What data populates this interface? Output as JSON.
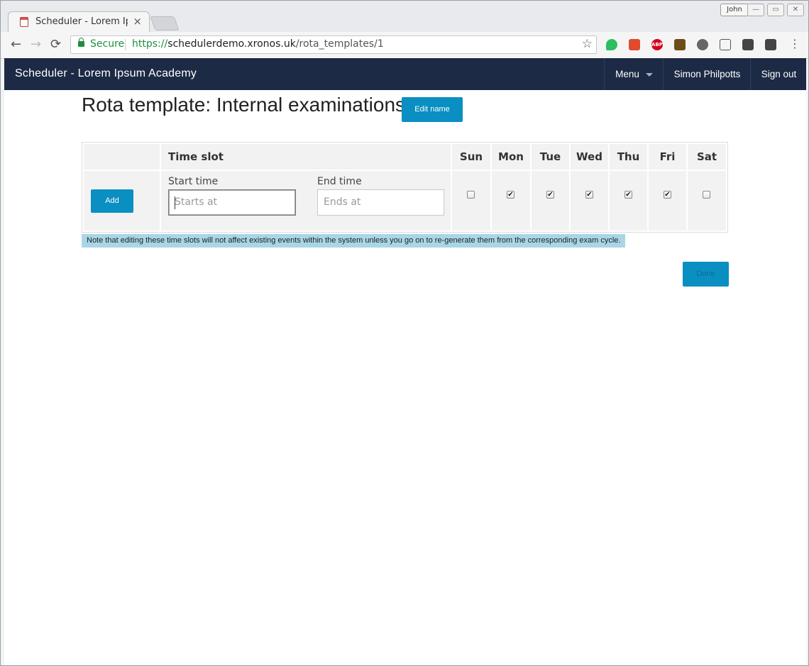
{
  "browser": {
    "tab_title": "Scheduler - Lorem Ipsum Academy",
    "tab_close": "×",
    "profile_name": "John",
    "window_buttons": [
      "—",
      "▭",
      "✕"
    ],
    "nav": {
      "back": "←",
      "forward": "→",
      "reload": "⟳"
    },
    "security_label": "Secure",
    "url_scheme": "https://",
    "url_host": "schedulerdemo.xronos.uk",
    "url_path": "/rota_templates/1",
    "bookmark_icon": "☆",
    "extension_icons": [
      "evernote-icon",
      "color-picker-icon",
      "adblock-plus-icon",
      "house-icon",
      "gnome-icon",
      "cast-icon",
      "keep-icon",
      "mail-checker-icon"
    ],
    "menu_icon": "⋮"
  },
  "navbar": {
    "brand": "Scheduler - Lorem Ipsum Academy",
    "menu_label": "Menu",
    "user_name": "Simon Philpotts",
    "sign_out": "Sign out",
    "bg_color": "#1d2a45"
  },
  "page": {
    "title": "Rota template: Internal examinations",
    "edit_name_label": "Edit name",
    "accent_color": "#0a8fc2",
    "table": {
      "time_slot_header": "Time slot",
      "days": [
        {
          "label": "Sun",
          "checked": false
        },
        {
          "label": "Mon",
          "checked": true
        },
        {
          "label": "Tue",
          "checked": true
        },
        {
          "label": "Wed",
          "checked": true
        },
        {
          "label": "Thu",
          "checked": true
        },
        {
          "label": "Fri",
          "checked": true
        },
        {
          "label": "Sat",
          "checked": false
        }
      ],
      "add_label": "Add",
      "start_label": "Start time",
      "start_placeholder": "Starts at",
      "end_label": "End time",
      "end_placeholder": "Ends at"
    },
    "note": "Note that editing these time slots will not affect existing events within the system unless you go on to re-generate them from the corresponding exam cycle.",
    "done_label": "Done"
  }
}
